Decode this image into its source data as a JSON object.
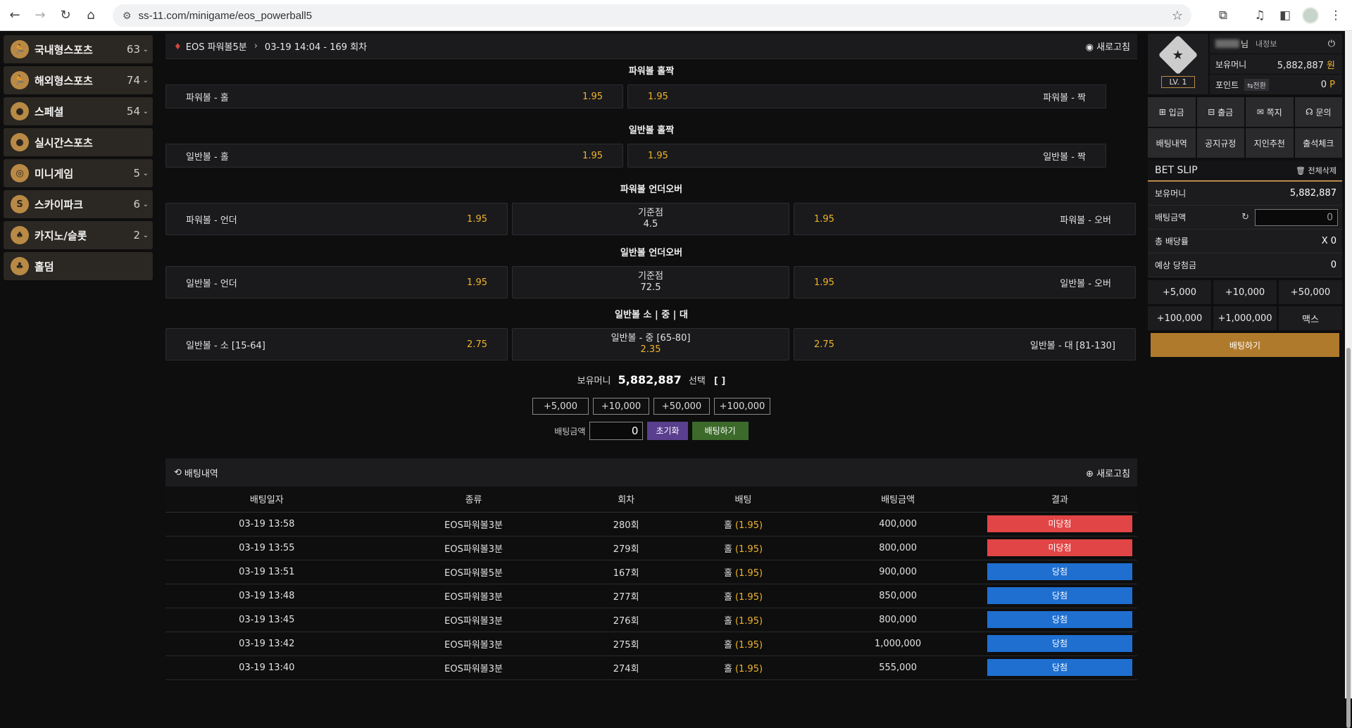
{
  "browser": {
    "url": "ss-11.com/minigame/eos_powerball5"
  },
  "sidebar": {
    "items": [
      {
        "label": "국내형스포츠",
        "count": "63",
        "icon": "runner-icon"
      },
      {
        "label": "해외형스포츠",
        "count": "74",
        "icon": "runner-icon"
      },
      {
        "label": "스페셜",
        "count": "54",
        "icon": "live-badge-icon"
      },
      {
        "label": "실시간스포츠",
        "count": "",
        "icon": "live-badge-icon"
      },
      {
        "label": "미니게임",
        "count": "5",
        "icon": "minigame-icon"
      },
      {
        "label": "스카이파크",
        "count": "6",
        "icon": "skypark-icon"
      },
      {
        "label": "카지노/슬롯",
        "count": "2",
        "icon": "cards-icon"
      },
      {
        "label": "홀덤",
        "count": "",
        "icon": "holdem-icon"
      }
    ]
  },
  "game": {
    "name": "EOS 파워볼5분",
    "round": "03-19 14:04 - 169 회차",
    "refresh_label": "새로고침"
  },
  "markets": {
    "pb_oddeven": {
      "title": "파워볼 홀짝",
      "left_label": "파워볼 - 홀",
      "left_odds": "1.95",
      "right_label": "파워볼 - 짝",
      "right_odds": "1.95"
    },
    "nb_oddeven": {
      "title": "일반볼 홀짝",
      "left_label": "일반볼 - 홀",
      "left_odds": "1.95",
      "right_label": "일반볼 - 짝",
      "right_odds": "1.95"
    },
    "pb_underover": {
      "title": "파워볼 언더오버",
      "left_label": "파워볼 - 언더",
      "left_odds": "1.95",
      "base_label": "기준점",
      "base_value": "4.5",
      "right_label": "파워볼 - 오버",
      "right_odds": "1.95"
    },
    "nb_underover": {
      "title": "일반볼 언더오버",
      "left_label": "일반볼 - 언더",
      "left_odds": "1.95",
      "base_label": "기준점",
      "base_value": "72.5",
      "right_label": "일반볼 - 오버",
      "right_odds": "1.95"
    },
    "nb_size": {
      "title": "일반볼 소 | 중 | 대",
      "left_label": "일반볼 - 소 [15-64]",
      "left_odds": "2.75",
      "mid_label": "일반볼 - 중 [65-80]",
      "mid_odds": "2.35",
      "right_label": "일반볼 - 대 [81-130]",
      "right_odds": "2.75"
    }
  },
  "bet_panel": {
    "balance_label": "보유머니",
    "balance": "5,882,887",
    "select_label": "선택",
    "select_value": "[ ]",
    "chips": [
      "+5,000",
      "+10,000",
      "+50,000",
      "+100,000"
    ],
    "amount_label": "배팅금액",
    "amount_value": "0",
    "reset_label": "초기화",
    "bet_label": "배팅하기"
  },
  "history": {
    "title": "배팅내역",
    "refresh_label": "새로고침",
    "columns": [
      "배팅일자",
      "종류",
      "회차",
      "배팅",
      "배팅금액",
      "결과"
    ],
    "rows": [
      {
        "date": "03-19 13:58",
        "type": "EOS파워볼3분",
        "round": "280회",
        "pick": "홀",
        "odds": "(1.95)",
        "amount": "400,000",
        "result": "미당첨",
        "status": "lose"
      },
      {
        "date": "03-19 13:55",
        "type": "EOS파워볼3분",
        "round": "279회",
        "pick": "홀",
        "odds": "(1.95)",
        "amount": "800,000",
        "result": "미당첨",
        "status": "lose"
      },
      {
        "date": "03-19 13:51",
        "type": "EOS파워볼5분",
        "round": "167회",
        "pick": "홀",
        "odds": "(1.95)",
        "amount": "900,000",
        "result": "당첨",
        "status": "win"
      },
      {
        "date": "03-19 13:48",
        "type": "EOS파워볼3분",
        "round": "277회",
        "pick": "홀",
        "odds": "(1.95)",
        "amount": "850,000",
        "result": "당첨",
        "status": "win"
      },
      {
        "date": "03-19 13:45",
        "type": "EOS파워볼3분",
        "round": "276회",
        "pick": "홀",
        "odds": "(1.95)",
        "amount": "800,000",
        "result": "당첨",
        "status": "win"
      },
      {
        "date": "03-19 13:42",
        "type": "EOS파워볼3분",
        "round": "275회",
        "pick": "홀",
        "odds": "(1.95)",
        "amount": "1,000,000",
        "result": "당첨",
        "status": "win"
      },
      {
        "date": "03-19 13:40",
        "type": "EOS파워볼3분",
        "round": "274회",
        "pick": "홀",
        "odds": "(1.95)",
        "amount": "555,000",
        "result": "당첨",
        "status": "win"
      }
    ]
  },
  "user": {
    "level": "LV. 1",
    "name_suffix": "님",
    "myinfo_label": "내정보",
    "money_label": "보유머니",
    "money_value": "5,882,887",
    "money_unit": "원",
    "point_label": "포인트",
    "point_convert": "⇆전환",
    "point_value": "0",
    "point_unit": "P"
  },
  "quick_menu": [
    "입금",
    "출금",
    "쪽지",
    "문의",
    "배팅내역",
    "공지규정",
    "지인추천",
    "출석체크"
  ],
  "slip": {
    "title": "BET SLIP",
    "clear_label": "전체삭제",
    "money_label": "보유머니",
    "money_value": "5,882,887",
    "amount_label": "배팅금액",
    "amount_value": "0",
    "total_odds_label": "총 배당률",
    "total_odds_value": "X 0",
    "expected_label": "예상 당첨금",
    "expected_value": "0",
    "amount_buttons": [
      "+5,000",
      "+10,000",
      "+50,000",
      "+100,000",
      "+1,000,000",
      "맥스"
    ],
    "bet_button": "배팅하기"
  },
  "colors": {
    "accent_gold": "#b98a45",
    "odds": "#f0b428",
    "lose": "#e24545",
    "win": "#1f6fd0"
  }
}
